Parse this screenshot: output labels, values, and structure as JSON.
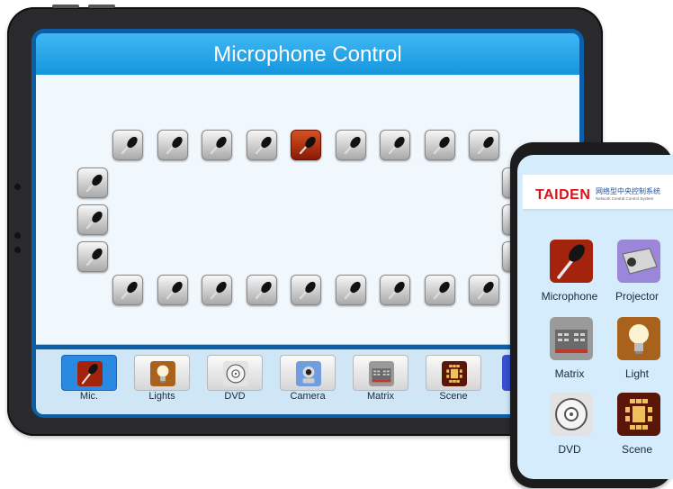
{
  "tablet": {
    "title": "Microphone Control",
    "mic_count": 24,
    "active_mic_index": 4,
    "dock": [
      {
        "label": "Mic.",
        "icon": "microphone-icon",
        "active": true
      },
      {
        "label": "Lights",
        "icon": "bulb-icon",
        "active": false
      },
      {
        "label": "DVD",
        "icon": "disc-icon",
        "active": false
      },
      {
        "label": "Camera",
        "icon": "camera-icon",
        "active": false
      },
      {
        "label": "Matrix",
        "icon": "matrix-icon",
        "active": false
      },
      {
        "label": "Scene",
        "icon": "scene-icon",
        "active": false
      }
    ]
  },
  "phone": {
    "brand": "TAIDEN",
    "tagline_cn": "网络型中央控制系统",
    "tagline_en": "Network Central Control System",
    "items": [
      {
        "label": "Microphone",
        "icon": "microphone-icon"
      },
      {
        "label": "Projector",
        "icon": "projector-icon"
      },
      {
        "label": "Matrix",
        "icon": "matrix-icon"
      },
      {
        "label": "Light",
        "icon": "bulb-icon"
      },
      {
        "label": "DVD",
        "icon": "disc-icon"
      },
      {
        "label": "Scene",
        "icon": "scene-icon"
      }
    ]
  },
  "colors": {
    "header_blue": "#1494dc",
    "active_mic": "#b7380f",
    "brand_red": "#d7131a"
  }
}
